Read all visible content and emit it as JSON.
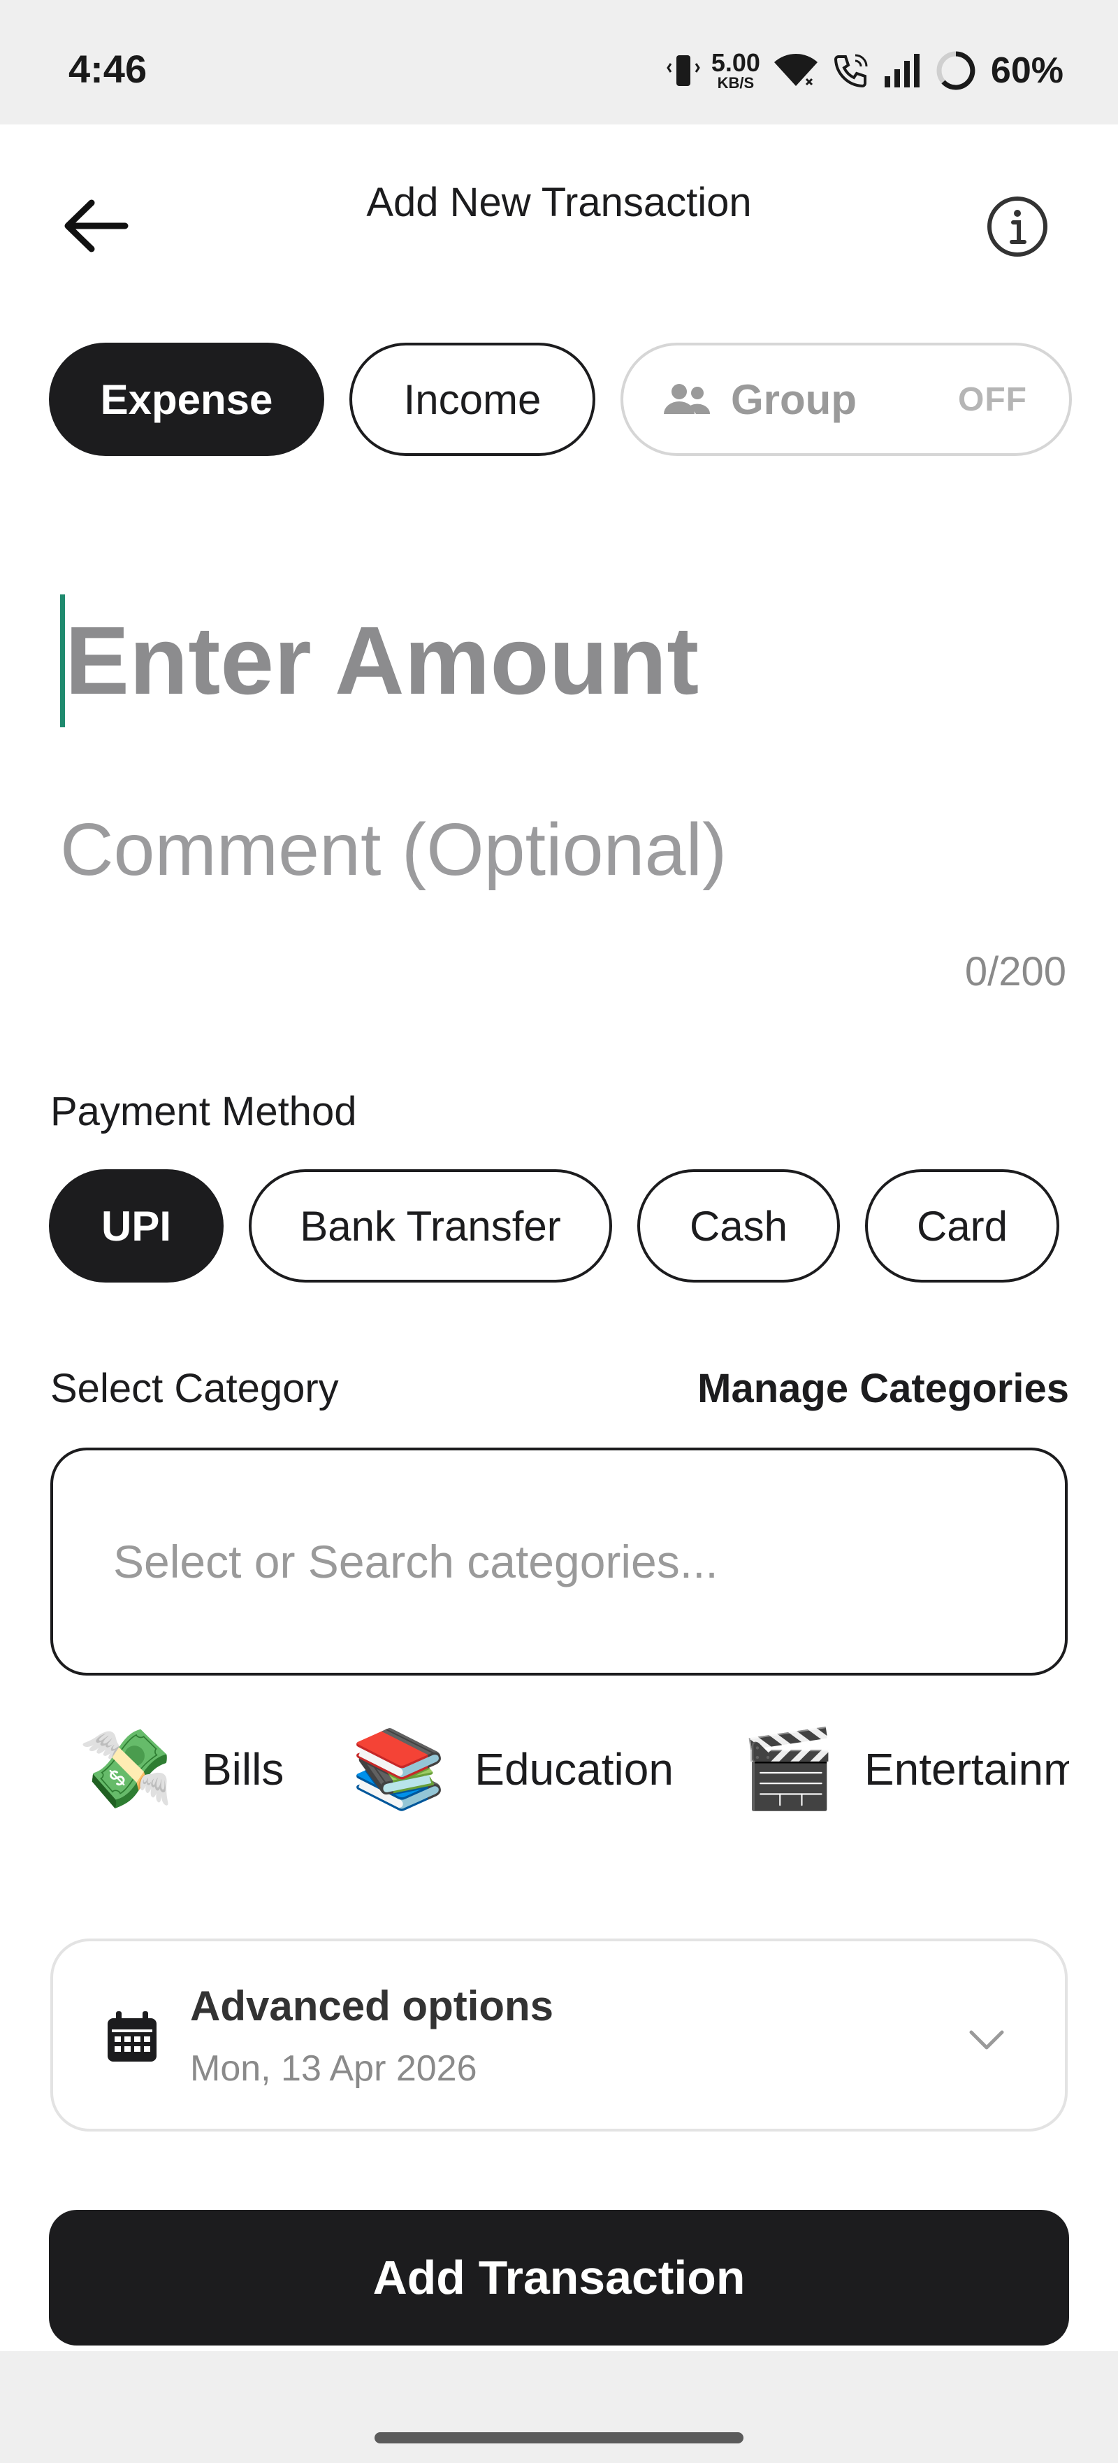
{
  "status_bar": {
    "time": "4:46",
    "net_speed_value": "5.00",
    "net_speed_unit": "KB/S",
    "battery": "60%",
    "icons": [
      "vibrate-icon",
      "wifi-icon",
      "wifi-calling-icon",
      "signal-icon",
      "battery-ring-icon"
    ]
  },
  "header": {
    "title": "Add New Transaction",
    "back_icon": "arrow-left-icon",
    "info_icon": "info-icon"
  },
  "type_toggle": {
    "expense": "Expense",
    "income": "Income",
    "group": "Group",
    "group_state": "OFF",
    "selected": "Expense"
  },
  "amount": {
    "placeholder": "Enter Amount",
    "value": ""
  },
  "comment": {
    "placeholder": "Comment (Optional)",
    "value": "",
    "counter": "0/200"
  },
  "payment": {
    "label": "Payment Method",
    "options": [
      "UPI",
      "Bank Transfer",
      "Cash",
      "Card"
    ],
    "selected": "UPI"
  },
  "category": {
    "label": "Select Category",
    "manage": "Manage Categories",
    "search_placeholder": "Select or Search categories...",
    "chips": [
      {
        "emoji": "💸",
        "label": "Bills"
      },
      {
        "emoji": "📚",
        "label": "Education"
      },
      {
        "emoji": "🎬",
        "label": "Entertainment"
      }
    ]
  },
  "advanced": {
    "title": "Advanced options",
    "date": "Mon, 13 Apr 2026"
  },
  "submit": {
    "label": "Add Transaction"
  },
  "colors": {
    "primary": "#1c1c1e",
    "caret": "#1f8a6e",
    "muted": "#8a8a8a",
    "border_light": "#e3e3e3"
  }
}
